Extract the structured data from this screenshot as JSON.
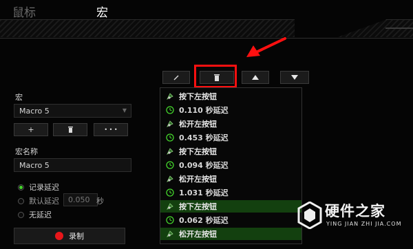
{
  "tabs": {
    "mouse": "鼠标",
    "macro": "宏"
  },
  "toolbar": {
    "edit": "edit-icon",
    "delete": "trash-icon",
    "up": "up-triangle-icon",
    "down": "down-triangle-icon"
  },
  "left": {
    "macro_label": "宏",
    "macro_select": "Macro 5",
    "add": "+",
    "delete": "trash-icon",
    "more": "• • •",
    "name_label": "宏名称",
    "name_value": "Macro 5",
    "opt_record": "记录延迟",
    "opt_default": "默认延迟",
    "default_value": "0.050",
    "default_unit": "秒",
    "opt_none": "无延迟",
    "record_button": "录制"
  },
  "list": [
    {
      "text": "按下左按钮",
      "kind": "mouse",
      "hl": false
    },
    {
      "text": "0.110 秒延迟",
      "kind": "delay",
      "hl": false
    },
    {
      "text": "松开左按钮",
      "kind": "mouse",
      "hl": false
    },
    {
      "text": "0.453 秒延迟",
      "kind": "delay",
      "hl": false
    },
    {
      "text": "按下左按钮",
      "kind": "mouse",
      "hl": false
    },
    {
      "text": "0.094 秒延迟",
      "kind": "delay",
      "hl": false
    },
    {
      "text": "松开左按钮",
      "kind": "mouse",
      "hl": false
    },
    {
      "text": "1.031 秒延迟",
      "kind": "delay",
      "hl": false
    },
    {
      "text": "按下左按钮",
      "kind": "mouse",
      "hl": true
    },
    {
      "text": "0.062 秒延迟",
      "kind": "delay",
      "hl": false
    },
    {
      "text": "松开左按钮",
      "kind": "mouse",
      "hl": true
    }
  ],
  "watermark": {
    "name": "硬件之家",
    "sub": "YING JIAN ZHI JIA.COM"
  },
  "colors": {
    "accent": "#44d62c",
    "highlight_row": "#13400f",
    "annotation": "#ff1010",
    "record": "#e8161a"
  }
}
